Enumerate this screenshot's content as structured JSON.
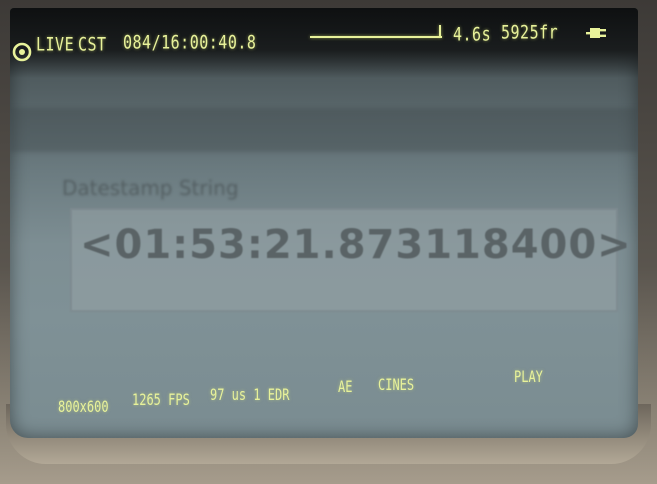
{
  "header": {
    "mode": "LIVE",
    "timezone": "CST",
    "datetime": "084/16:00:40.8",
    "duration": "4.6s",
    "frames": "5925fr"
  },
  "overlay": {
    "field_label": "Datestamp String",
    "timestamp": "<01:53:21.873118400>"
  },
  "footer": {
    "resolution": "800x600",
    "fps": "1265 FPS",
    "exposure": "97 us 1 EDR",
    "ae": "AE",
    "cines": "CINES",
    "play": "PLAY"
  },
  "icons": {
    "record": "record-icon",
    "power": "power-plug-icon"
  },
  "colors": {
    "hud_text": "#e8f29a",
    "screen": "#7d8e93"
  }
}
